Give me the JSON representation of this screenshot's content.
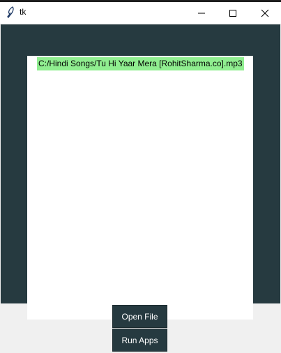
{
  "window": {
    "title": "tk",
    "controls": {
      "minimize_icon": "minimize-icon",
      "maximize_icon": "maximize-icon",
      "close_icon": "close-icon"
    }
  },
  "main": {
    "selected_file": "C:/Hindi Songs/Tu Hi Yaar Mera [RohitSharma.co].mp3",
    "buttons": {
      "open_file": "Open File",
      "run_apps": "Run Apps"
    }
  },
  "colors": {
    "panel": "#263a40",
    "label_bg": "#90ee90",
    "canvas": "#ffffff"
  }
}
